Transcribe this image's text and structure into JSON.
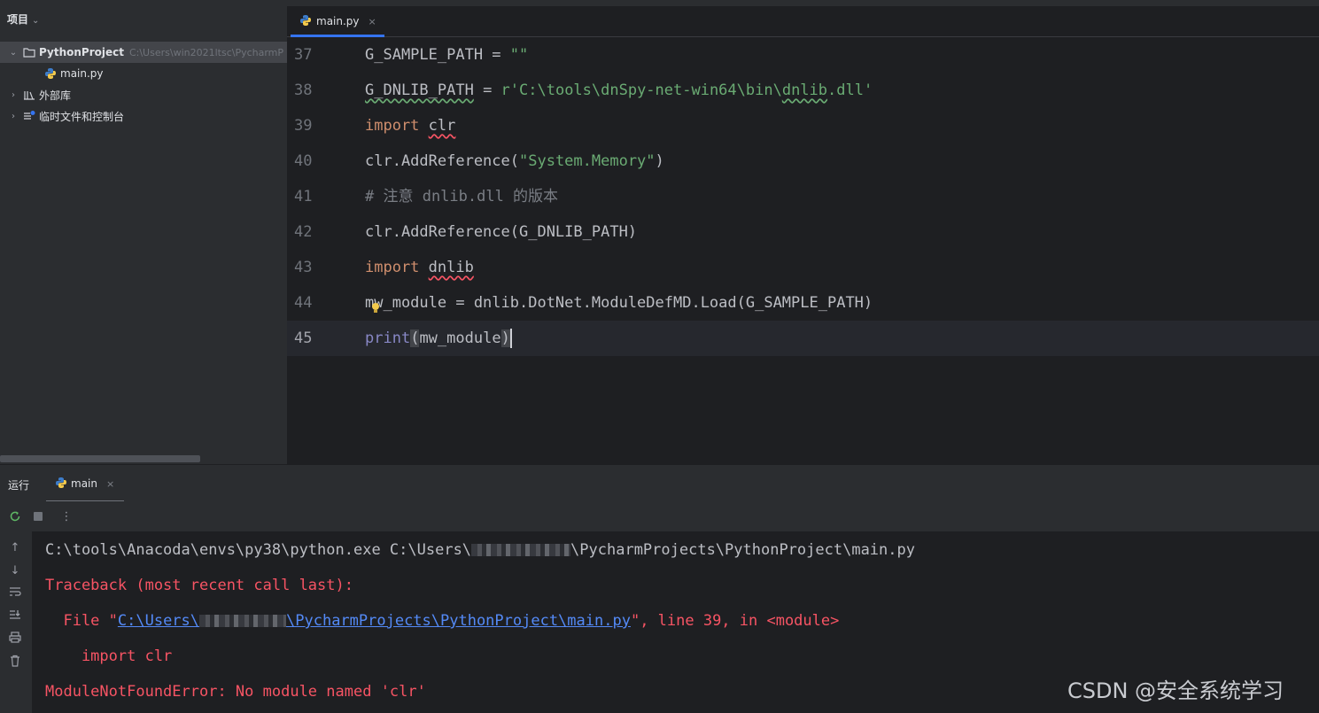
{
  "project_panel": {
    "title": "项目",
    "title_chevron": "chevron-down-icon",
    "tree": [
      {
        "label": "PythonProject",
        "path": "C:\\Users\\win2021ltsc\\PycharmP",
        "icon": "folder-icon",
        "expanded": true,
        "selected": true
      },
      {
        "label": "main.py",
        "icon": "python-file-icon"
      },
      {
        "label": "外部库",
        "icon": "library-icon",
        "expanded": false
      },
      {
        "label": "临时文件和控制台",
        "icon": "scratch-icon",
        "expanded": false
      }
    ]
  },
  "editor": {
    "tab": {
      "label": "main.py",
      "close": "×"
    },
    "line_numbers": [
      "37",
      "38",
      "39",
      "40",
      "41",
      "42",
      "43",
      "44",
      "45"
    ],
    "current_line": "45",
    "code": {
      "l37_a": "G_SAMPLE_PATH = ",
      "l37_str": "\"\"",
      "l38_var": "G_DNLIB_PATH",
      "l38_eq": " = ",
      "l38_str_a": "r'C:\\tools\\dnSpy-net-win64\\bin\\",
      "l38_str_b": "dnlib",
      "l38_str_c": ".dll'",
      "l39_kw": "import",
      "l39_mod": "clr",
      "l40_a": "clr.AddReference(",
      "l40_str": "\"System.Memory\"",
      "l40_b": ")",
      "l41_cmt": "# 注意 dnlib.dll 的版本",
      "l42": "clr.AddReference(G_DNLIB_PATH)",
      "l43_kw": "import",
      "l43_mod": "dnlib",
      "l44": "mw_module = dnlib.DotNet.ModuleDefMD.Load(G_SAMPLE_PATH)",
      "l45_fn": "print",
      "l45_open": "(",
      "l45_arg": "mw_module",
      "l45_close": ")"
    }
  },
  "run_panel": {
    "title": "运行",
    "tab": {
      "label": "main",
      "close": "×"
    },
    "toolbar": [
      "rerun-icon",
      "stop-icon",
      "more-icon"
    ],
    "side": [
      "up-arrow-icon",
      "down-arrow-icon",
      "soft-wrap-icon",
      "scroll-to-end-icon",
      "print-icon",
      "trash-icon"
    ],
    "output": {
      "cmd_a": "C:\\tools\\Anacoda\\envs\\py38\\python.exe C:\\Users\\",
      "cmd_b": "\\PycharmProjects\\PythonProject\\main.py",
      "traceback": "Traceback (most recent call last):",
      "file_a": "  File \"",
      "file_link_a": "C:\\Users\\",
      "file_link_b": "\\PycharmProjects\\PythonProject\\main.py",
      "file_c": "\", line 39, in <module>",
      "import_line": "    import clr",
      "error": "ModuleNotFoundError: No module named 'clr'"
    }
  },
  "watermark": "CSDN @安全系统学习",
  "colors": {
    "keyword": "#cf8e6d",
    "string": "#6aab73",
    "error": "#f75464",
    "link": "#548af7",
    "accent": "#3574f0"
  }
}
